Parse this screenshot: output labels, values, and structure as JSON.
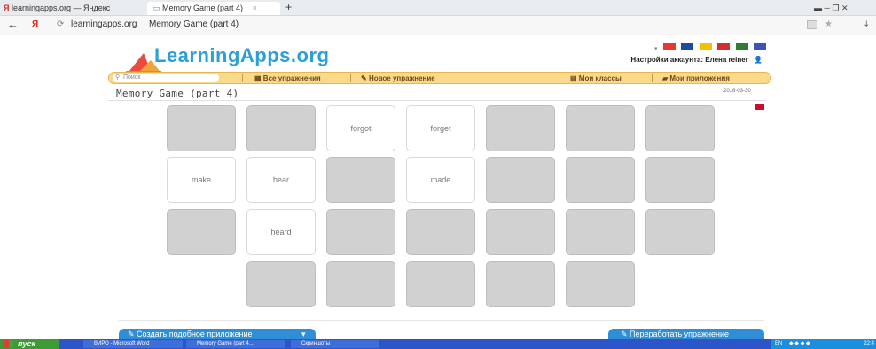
{
  "browser": {
    "tabs": [
      {
        "label": "learningapps.org — Яндекс"
      },
      {
        "label": "Memory Game (part 4)"
      }
    ],
    "tab_close": "×",
    "new_tab": "+",
    "back": "←",
    "yandex_logo": "Я",
    "reload": "⟳",
    "url_domain": "learningapps.org",
    "url_title": "Memory Game (part 4)",
    "window_controls": "▬ ─ ❐ ✕"
  },
  "site": {
    "logo": "LearningApps.org",
    "account_label": "Настройки аккаунта: Елена reiner",
    "search_placeholder": "Поиск",
    "nav": {
      "all_exercises": "Все упражнения",
      "new_exercise": "Новое упражнение",
      "my_classes": "Мои классы",
      "my_apps": "Мои приложения"
    }
  },
  "exercise": {
    "title": "Memory Game (part 4)",
    "date": "2018-03-30"
  },
  "cards": [
    {
      "label": ""
    },
    {
      "label": ""
    },
    {
      "label": "forgot"
    },
    {
      "label": "forget"
    },
    {
      "label": ""
    },
    {
      "label": ""
    },
    {
      "label": ""
    },
    {
      "label": "make"
    },
    {
      "label": "hear"
    },
    {
      "label": ""
    },
    {
      "label": "made"
    },
    {
      "label": ""
    },
    {
      "label": ""
    },
    {
      "label": ""
    },
    {
      "label": ""
    },
    {
      "label": "heard"
    },
    {
      "label": ""
    },
    {
      "label": ""
    },
    {
      "label": ""
    },
    {
      "label": ""
    },
    {
      "label": ""
    },
    {
      "label": ""
    },
    {
      "label": ""
    },
    {
      "label": ""
    },
    {
      "label": ""
    },
    {
      "label": ""
    }
  ],
  "footer": {
    "create_similar": "Создать подобное приложение",
    "rework": "Переработать упражнение"
  },
  "taskbar": {
    "start": "пуск",
    "tasks": [
      "ВИРО - Microsoft Word",
      "Memory Game (part 4...",
      "Скриншоты"
    ],
    "lang": "EN",
    "time": "22:4"
  },
  "colors": {
    "accent": "#2a9fd8",
    "nav_bg": "#fbd98a",
    "card_hidden": "#d1d1d1",
    "taskbar": "#2b55c8",
    "start": "#3c9b34"
  }
}
